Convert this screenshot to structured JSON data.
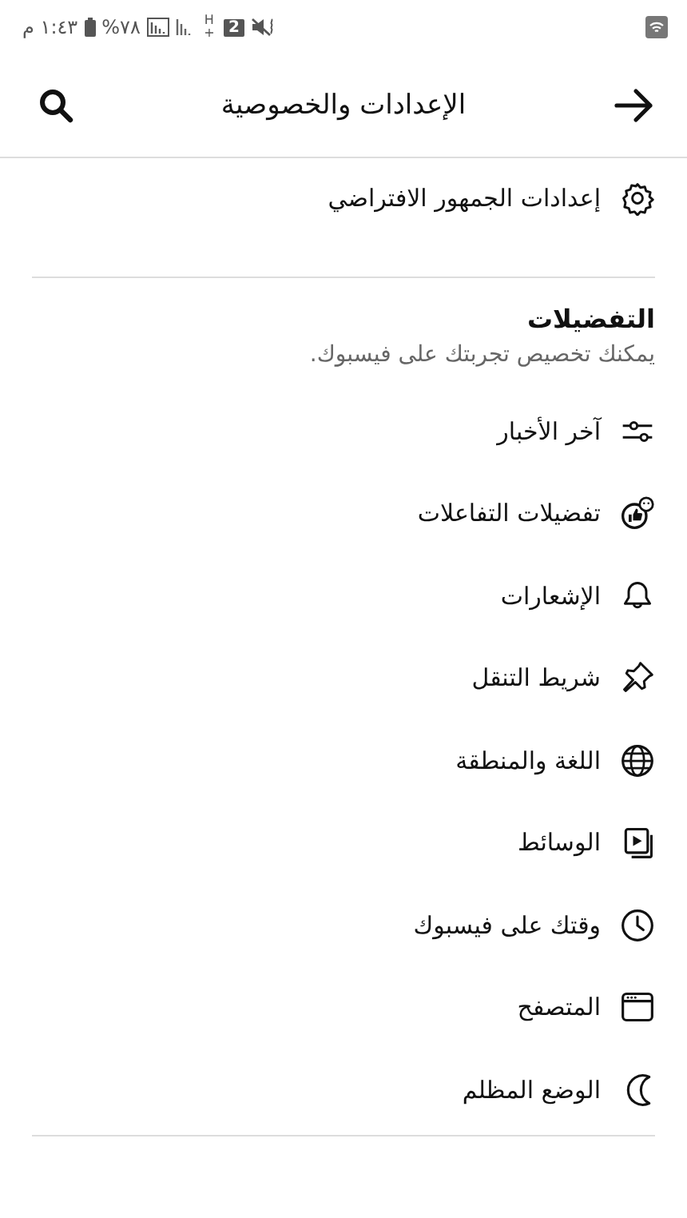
{
  "status_bar": {
    "time": "١:٤٣ م",
    "battery": "%٧٨",
    "sim": "2",
    "network": "H+"
  },
  "header": {
    "title": "الإعدادات والخصوصية"
  },
  "audience": {
    "label": "إعدادات الجمهور الافتراضي",
    "kind": "gear"
  },
  "preferences": {
    "title": "التفضيلات",
    "subtitle": "يمكنك تخصيص تجربتك على فيسبوك.",
    "items": [
      {
        "label": "آخر الأخبار",
        "kind": "sliders"
      },
      {
        "label": "تفضيلات التفاعلات",
        "kind": "reactions"
      },
      {
        "label": "الإشعارات",
        "kind": "bell"
      },
      {
        "label": "شريط التنقل",
        "kind": "pin"
      },
      {
        "label": "اللغة والمنطقة",
        "kind": "globe"
      },
      {
        "label": "الوسائط",
        "kind": "media"
      },
      {
        "label": "وقتك على فيسبوك",
        "kind": "clock"
      },
      {
        "label": "المتصفح",
        "kind": "browser"
      },
      {
        "label": "الوضع المظلم",
        "kind": "moon"
      }
    ]
  }
}
